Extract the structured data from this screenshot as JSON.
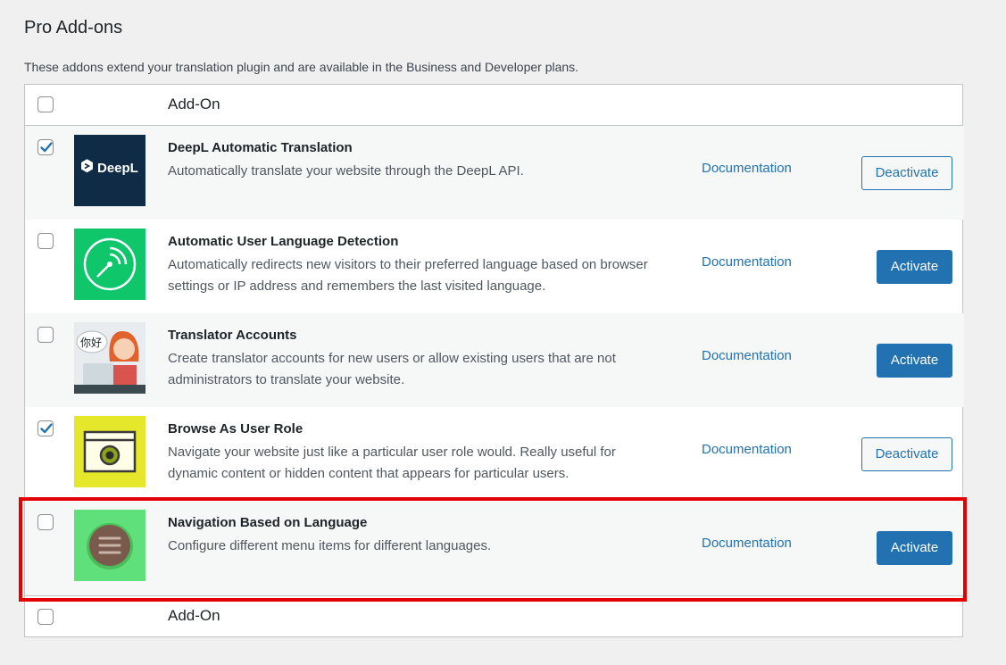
{
  "page": {
    "title": "Pro Add-ons",
    "description": "These addons extend your translation plugin and are available in the Business and Developer plans."
  },
  "table": {
    "header_label": "Add-On",
    "footer_label": "Add-On",
    "addons": [
      {
        "title": "DeepL Automatic Translation",
        "description": "Automatically translate your website through the DeepL API.",
        "doc_label": "Documentation",
        "action_label": "Deactivate",
        "checked": true,
        "logo_text": "DeepL"
      },
      {
        "title": "Automatic User Language Detection",
        "description": "Automatically redirects new visitors to their preferred language based on browser settings or IP address and remembers the last visited language.",
        "doc_label": "Documentation",
        "action_label": "Activate",
        "checked": false
      },
      {
        "title": "Translator Accounts",
        "description": "Create translator accounts for new users or allow existing users that are not administrators to translate your website.",
        "doc_label": "Documentation",
        "action_label": "Activate",
        "checked": false,
        "bubble_text": "你好"
      },
      {
        "title": "Browse As User Role",
        "description": "Navigate your website just like a particular user role would. Really useful for dynamic content or hidden content that appears for particular users.",
        "doc_label": "Documentation",
        "action_label": "Deactivate",
        "checked": true
      },
      {
        "title": "Navigation Based on Language",
        "description": "Configure different menu items for different languages.",
        "doc_label": "Documentation",
        "action_label": "Activate",
        "checked": false
      }
    ]
  },
  "colors": {
    "accent": "#2271b1",
    "highlight": "#e50000",
    "deepl_bg": "#0f2b46",
    "detect_bg": "#0fc66b",
    "browse_bg": "#e5e82a",
    "nav_bg": "#5fe07a"
  }
}
